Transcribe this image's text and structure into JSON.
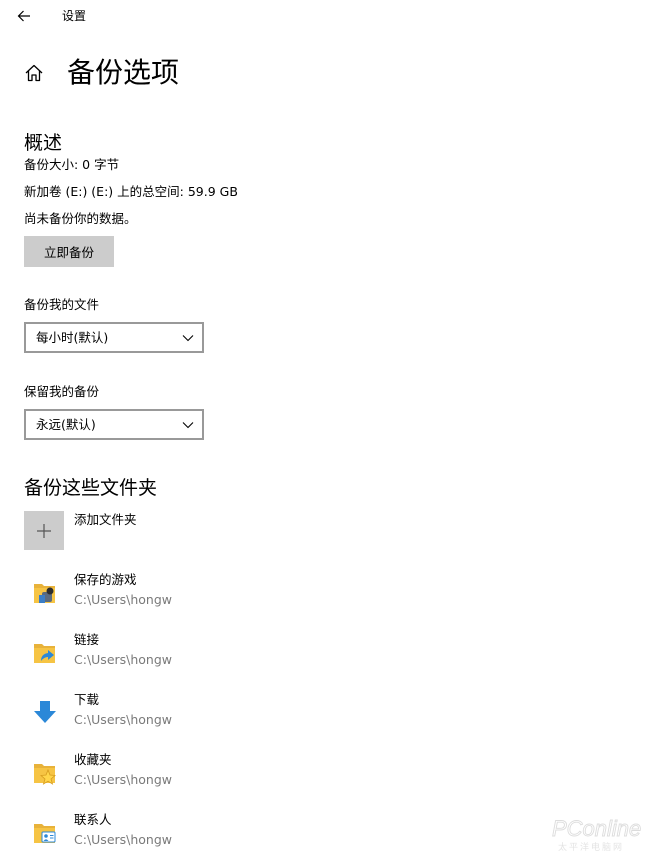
{
  "window": {
    "title": "设置"
  },
  "header": {
    "title": "备份选项"
  },
  "overview": {
    "heading": "概述",
    "backup_size": "备份大小: 0 字节",
    "total_space": "新加卷 (E:) (E:) 上的总空间: 59.9 GB",
    "status": "尚未备份你的数据。",
    "backup_now_label": "立即备份"
  },
  "backup_frequency": {
    "label": "备份我的文件",
    "selected": "每小时(默认)"
  },
  "keep_backups": {
    "label": "保留我的备份",
    "selected": "永远(默认)"
  },
  "folders": {
    "heading": "备份这些文件夹",
    "add_label": "添加文件夹",
    "items": [
      {
        "name": "保存的游戏",
        "path": "C:\\Users\\hongw",
        "icon": "saved-games-icon"
      },
      {
        "name": "链接",
        "path": "C:\\Users\\hongw",
        "icon": "links-folder-icon"
      },
      {
        "name": "下载",
        "path": "C:\\Users\\hongw",
        "icon": "downloads-arrow-icon"
      },
      {
        "name": "收藏夹",
        "path": "C:\\Users\\hongw",
        "icon": "favorites-folder-icon"
      },
      {
        "name": "联系人",
        "path": "C:\\Users\\hongw",
        "icon": "contacts-folder-icon"
      }
    ]
  },
  "colors": {
    "button_bg": "#cccccc",
    "dropdown_border": "#999999",
    "secondary_text": "#7a7a7a",
    "folder_yellow": "#f6c444",
    "accent_blue": "#2b88d8"
  },
  "watermark": {
    "brand": "PConline",
    "tagline": "太平洋电脑网"
  }
}
